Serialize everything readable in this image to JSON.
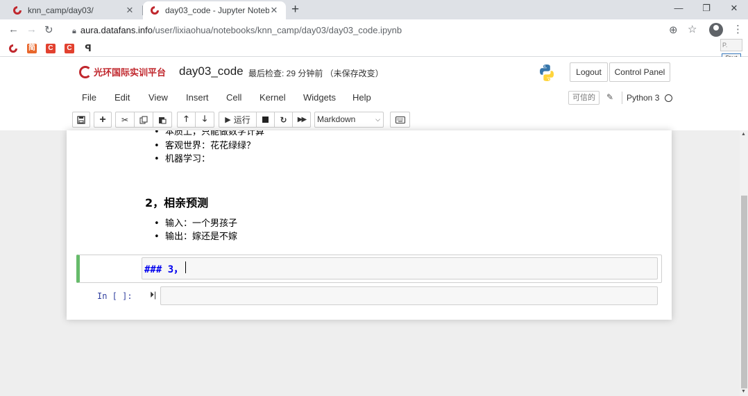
{
  "browser": {
    "tabs": [
      {
        "title": "knn_camp/day03/",
        "close": "✕"
      },
      {
        "title": "day03_code - Jupyter Notebo",
        "close": "✕"
      }
    ],
    "new_tab": "+",
    "window_controls": [
      "—",
      "❐",
      "✕"
    ],
    "url_host": "aura.datafans.info",
    "url_path": "/user/lixiaohua/notebooks/knn_camp/day03/day03_code.ipynb",
    "bookmarks": [
      {
        "icon": "swirl-logo-icon",
        "color": "#c0272d"
      },
      {
        "icon": "简",
        "color": "#e8672c"
      },
      {
        "icon": "C",
        "color": "#e2412f"
      },
      {
        "icon": "C",
        "color": "#e2412f"
      },
      {
        "icon": "ꟼ",
        "color": "#333333"
      }
    ],
    "extension_badge": "P.",
    "extension_start": "Start"
  },
  "jupyter": {
    "logo_text": "光环国际实训平台",
    "notebook_name": "day03_code",
    "checkpoint": "最后检查: 29 分钟前 （未保存改变）",
    "logout": "Logout",
    "control_panel": "Control Panel",
    "menu": [
      "File",
      "Edit",
      "View",
      "Insert",
      "Cell",
      "Kernel",
      "Widgets",
      "Help"
    ],
    "trusted": "可信的",
    "kernel_name": "Python 3",
    "toolbar": {
      "run_label": "运行",
      "cell_type": "Markdown"
    }
  },
  "notebook": {
    "partial_bullet": "本质上，只能做数学计算",
    "bullets_top": [
      "客观世界：花花绿绿？",
      "机器学习："
    ],
    "heading": "2，相亲预测",
    "bullets_bottom": [
      "输入：一个男孩子",
      "输出：嫁还是不嫁"
    ],
    "editing_text": "### 3，",
    "code_prompt": "In  [  ]:"
  },
  "colors": {
    "brand_red": "#c0272d",
    "edit_mode_border": "#66bb6a",
    "markdown_heading_blue": "#0000ee",
    "prompt_blue": "#303f9f"
  }
}
